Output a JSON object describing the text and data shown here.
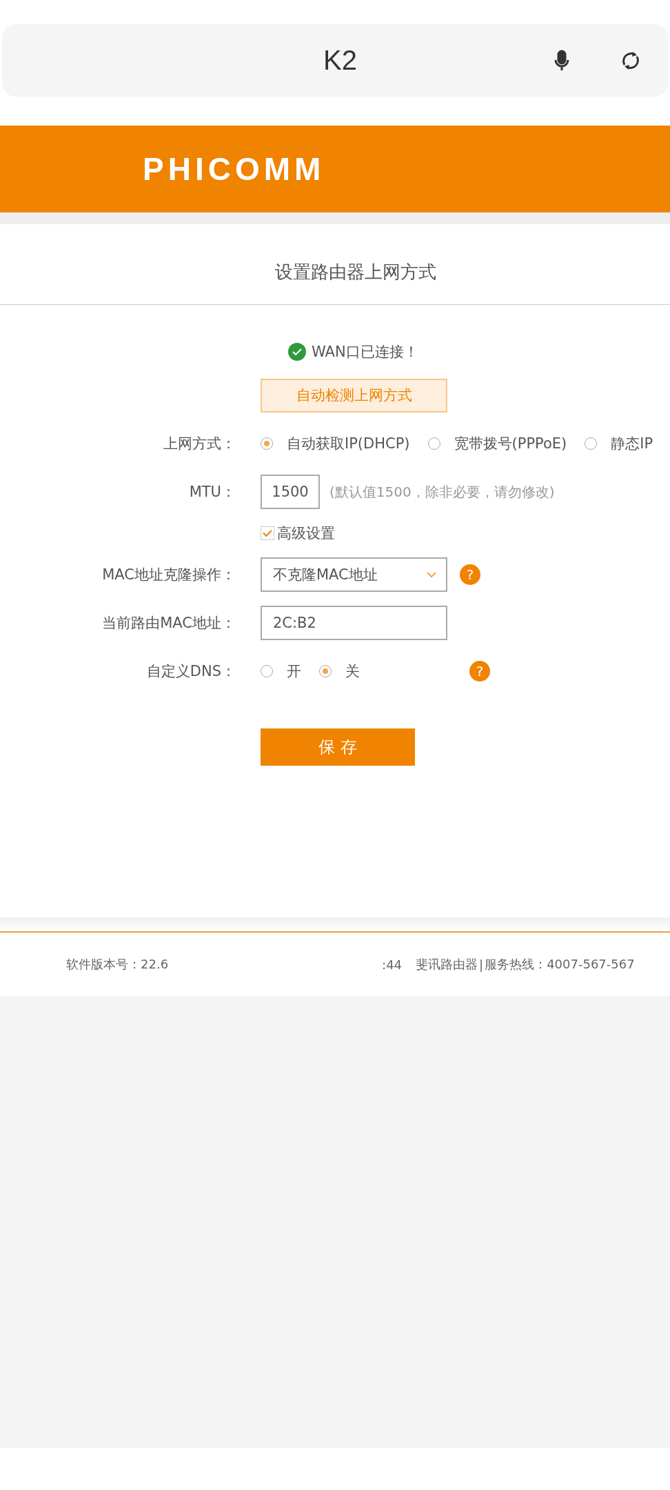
{
  "address_bar": {
    "text": "K2"
  },
  "header": {
    "logo": "PHICOMM"
  },
  "page_title": "设置路由器上网方式",
  "wan_status": {
    "connected": true,
    "text": "WAN口已连接！"
  },
  "detect_button": "自动检测上网方式",
  "connection_type": {
    "label": "上网方式：",
    "options": [
      {
        "label": "自动获取IP(DHCP)",
        "selected": true
      },
      {
        "label": "宽带拨号(PPPoE)",
        "selected": false
      },
      {
        "label": "静态IP",
        "selected": false
      }
    ]
  },
  "mtu": {
    "label": "MTU：",
    "value": "1500",
    "hint": "(默认值1500，除非必要，请勿修改)"
  },
  "advanced": {
    "label": "高级设置",
    "checked": true
  },
  "mac_clone": {
    "label": "MAC地址克隆操作：",
    "value": "不克隆MAC地址",
    "help": "?"
  },
  "router_mac": {
    "label": "当前路由MAC地址：",
    "value": "2C:B2"
  },
  "custom_dns": {
    "label": "自定义DNS：",
    "options": [
      {
        "label": "开",
        "selected": false
      },
      {
        "label": "关",
        "selected": true
      }
    ],
    "help": "?"
  },
  "save_button": "保 存",
  "footer": {
    "version": "软件版本号：22.6",
    "time": ":44",
    "brand": "斐讯路由器",
    "separator": "|",
    "hotline": "服务热线：4007-567-567"
  }
}
